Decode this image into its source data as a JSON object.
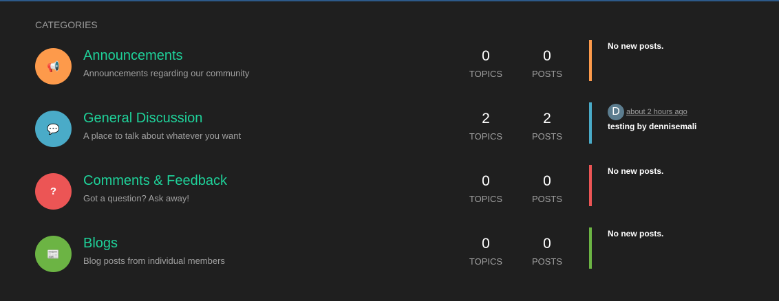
{
  "header": "CATEGORIES",
  "categories": [
    {
      "title": "Announcements",
      "desc": "Announcements regarding our community",
      "icon": "megaphone-icon",
      "glyph": "📢",
      "color": "#fd9a4b",
      "topics": "0",
      "posts": "0",
      "last": "No new posts."
    },
    {
      "title": "General Discussion",
      "desc": "A place to talk about whatever you want",
      "icon": "comments-icon",
      "glyph": "💬",
      "color": "#4aabc8",
      "topics": "2",
      "posts": "2",
      "last_avatar": "D",
      "last_time": "about 2 hours ago",
      "last_text": "testing by dennisemali"
    },
    {
      "title": "Comments & Feedback",
      "desc": "Got a question? Ask away!",
      "icon": "question-icon",
      "glyph": "?",
      "color": "#ec5555",
      "topics": "0",
      "posts": "0",
      "last": "No new posts."
    },
    {
      "title": "Blogs",
      "desc": "Blog posts from individual members",
      "icon": "newspaper-icon",
      "glyph": "📰",
      "color": "#6cb444",
      "topics": "0",
      "posts": "0",
      "last": "No new posts."
    }
  ],
  "labels": {
    "topics": "TOPICS",
    "posts": "POSTS"
  }
}
